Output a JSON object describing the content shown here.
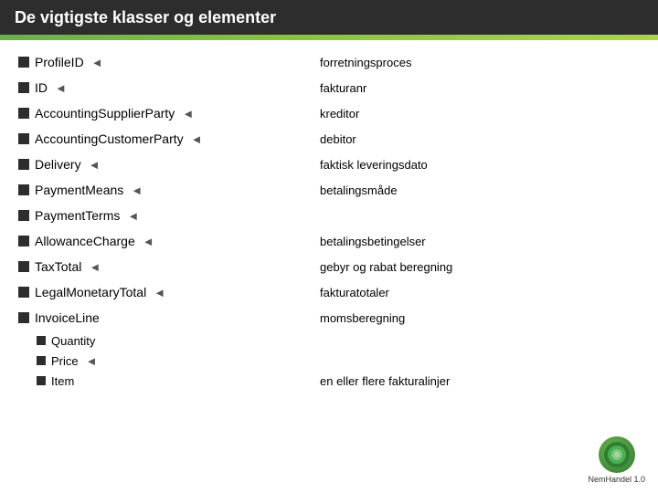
{
  "header": {
    "title": "De vigtigste klasser og elementer"
  },
  "items": [
    {
      "id": "profileid",
      "label": "ProfileID",
      "hasArrow": true,
      "description": "forretningsproces"
    },
    {
      "id": "id",
      "label": "ID",
      "hasArrow": true,
      "description": "fakturanr"
    },
    {
      "id": "accounting-supplier",
      "label": "AccountingSupplierParty",
      "hasArrow": true,
      "description": "kreditor"
    },
    {
      "id": "accounting-customer",
      "label": "AccountingCustomerParty",
      "hasArrow": true,
      "description": "debitor"
    },
    {
      "id": "delivery",
      "label": "Delivery",
      "hasArrow": true,
      "description": "faktisk leveringsdato"
    },
    {
      "id": "payment-means",
      "label": "PaymentMeans",
      "hasArrow": true,
      "description": "betalingsmåde"
    },
    {
      "id": "payment-terms",
      "label": "PaymentTerms",
      "hasArrow": true,
      "description": ""
    },
    {
      "id": "allowance-charge",
      "label": "AllowanceCharge",
      "hasArrow": true,
      "description": "betalingsbetingelser"
    },
    {
      "id": "tax-total",
      "label": "TaxTotal",
      "hasArrow": true,
      "description": "gebyr og rabat beregning"
    },
    {
      "id": "legal-monetary",
      "label": "LegalMonetaryTotal",
      "hasArrow": true,
      "description": ""
    },
    {
      "id": "invoice-line",
      "label": "InvoiceLine",
      "hasArrow": false,
      "description": "momsberegning"
    }
  ],
  "payment_terms_desc": "betalingsbetingelser",
  "legal_monetary_desc": "fakturatotaler",
  "invoice_line_desc": "en eller flere fakturalinjer",
  "sub_items": [
    {
      "id": "quantity",
      "label": "Quantity",
      "hasArrow": false
    },
    {
      "id": "price",
      "label": "Price",
      "hasArrow": true
    },
    {
      "id": "item",
      "label": "Item",
      "hasArrow": false
    }
  ],
  "logo": {
    "text": "NemHandel 1.0"
  }
}
